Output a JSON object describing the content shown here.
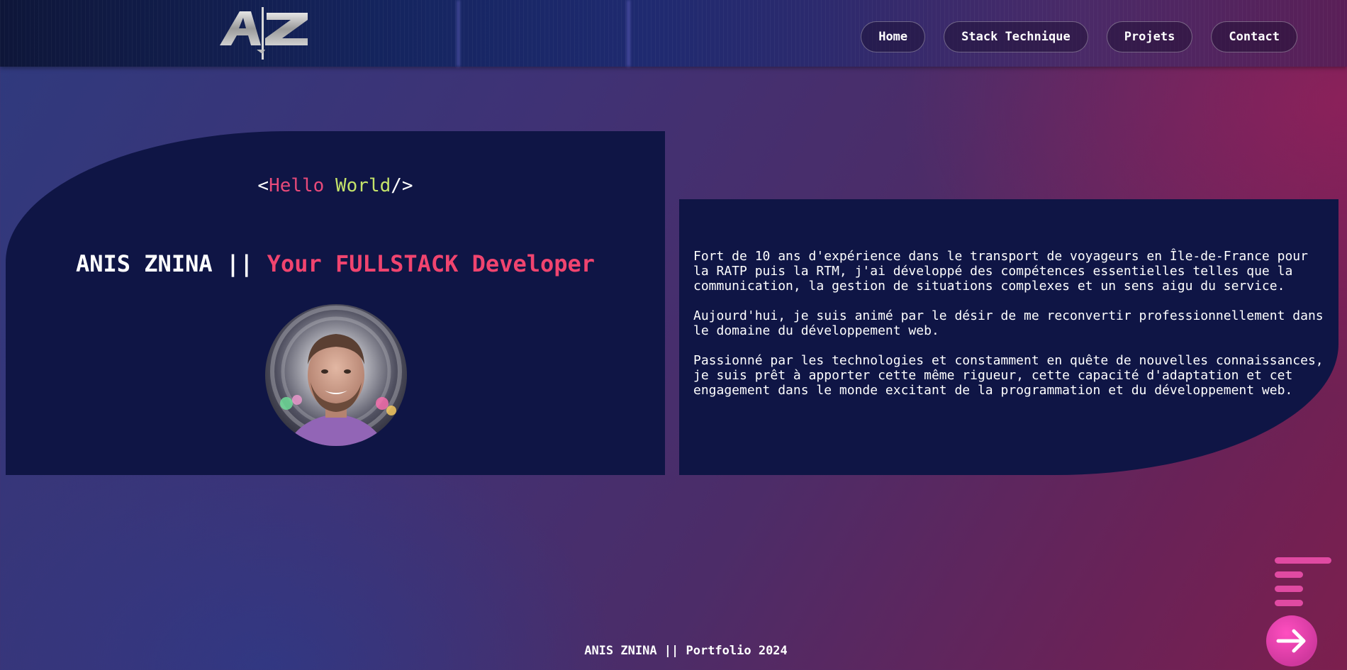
{
  "header": {
    "logo_text": "AZ",
    "nav": [
      {
        "label": "Home"
      },
      {
        "label": "Stack Technique"
      },
      {
        "label": "Projets"
      },
      {
        "label": "Contact"
      }
    ]
  },
  "hero": {
    "hello_open": "<",
    "hello_word1": "Hello",
    "hello_word2": "World",
    "hello_close": "/>",
    "name": "ANIS ZNINA || ",
    "role": "Your FULLSTACK Developer"
  },
  "bio": {
    "paragraphs": [
      "Fort de 10 ans d'expérience dans le transport de voyageurs en Île-de-France pour\nla RATP puis la RTM, j'ai développé des compétences essentielles telles que la\ncommunication, la gestion de situations complexes et un sens aigu du service.",
      "Aujourd'hui, je suis animé par le désir de me reconvertir professionnellement dans\nle domaine du développement web.",
      "Passionné par les technologies et constamment en quête de nouvelles connaissances,\nje suis prêt à apporter cette même rigueur, cette capacité d'adaptation et cet\nengagement dans le monde excitant de la programmation et du développement web."
    ]
  },
  "footer": {
    "text": "ANIS ZNINA || Portfolio 2024"
  },
  "colors": {
    "card": "#0f1545",
    "accent_pink": "#f0446f",
    "accent_green": "#c4e36a",
    "menu_pink": "#e04aa2"
  },
  "icons": {
    "menu": "menu-bars-icon",
    "next": "arrow-right-icon",
    "logo": "az-logo-icon"
  }
}
